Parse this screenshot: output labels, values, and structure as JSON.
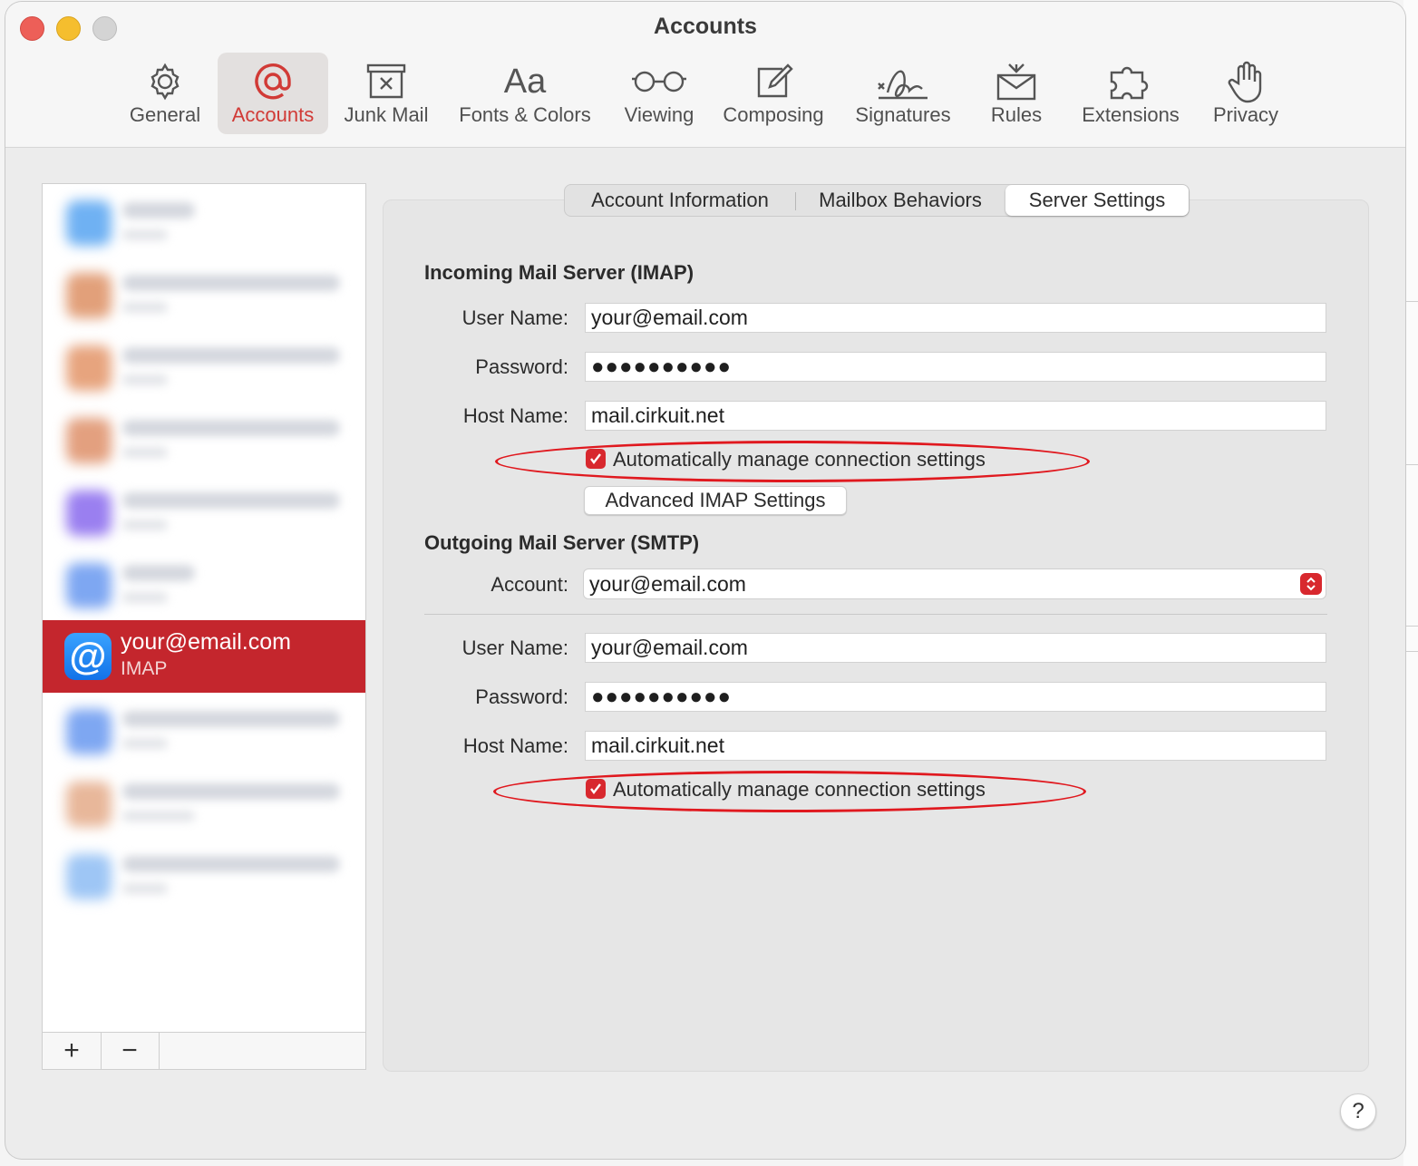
{
  "window": {
    "title": "Accounts"
  },
  "toolbar": {
    "items": [
      {
        "label": "General",
        "icon": "gear-icon"
      },
      {
        "label": "Accounts",
        "icon": "at-sign-icon"
      },
      {
        "label": "Junk Mail",
        "icon": "junk-tray-icon"
      },
      {
        "label": "Fonts & Colors",
        "icon": "font-aa-icon",
        "glyph": "Aa"
      },
      {
        "label": "Viewing",
        "icon": "glasses-icon"
      },
      {
        "label": "Composing",
        "icon": "compose-pencil-icon"
      },
      {
        "label": "Signatures",
        "icon": "signature-icon"
      },
      {
        "label": "Rules",
        "icon": "rules-envelope-icon"
      },
      {
        "label": "Extensions",
        "icon": "puzzle-icon"
      },
      {
        "label": "Privacy",
        "icon": "hand-icon"
      }
    ],
    "active": "Accounts"
  },
  "sidebar": {
    "selected_account": {
      "name": "your@email.com",
      "type": "IMAP",
      "icon_glyph": "@"
    },
    "add_label": "+",
    "remove_label": "−"
  },
  "tabs": {
    "items": [
      "Account Information",
      "Mailbox Behaviors",
      "Server Settings"
    ],
    "active": "Server Settings"
  },
  "incoming": {
    "title": "Incoming Mail Server (IMAP)",
    "username_label": "User Name:",
    "username": "your@email.com",
    "password_label": "Password:",
    "password": "●●●●●●●●●●",
    "host_label": "Host Name:",
    "host": "mail.cirkuit.net",
    "auto_label": "Automatically manage connection settings",
    "auto_checked": true,
    "advanced_button": "Advanced IMAP Settings"
  },
  "outgoing": {
    "title": "Outgoing Mail Server (SMTP)",
    "account_label": "Account:",
    "account": "your@email.com",
    "username_label": "User Name:",
    "username": "your@email.com",
    "password_label": "Password:",
    "password": "●●●●●●●●●●",
    "host_label": "Host Name:",
    "host": "mail.cirkuit.net",
    "auto_label": "Automatically manage connection settings",
    "auto_checked": true
  },
  "help": {
    "label": "?"
  },
  "colors": {
    "accent": "#d8282e",
    "selection": "#c4262d",
    "annotation_ring": "#e0191f"
  }
}
